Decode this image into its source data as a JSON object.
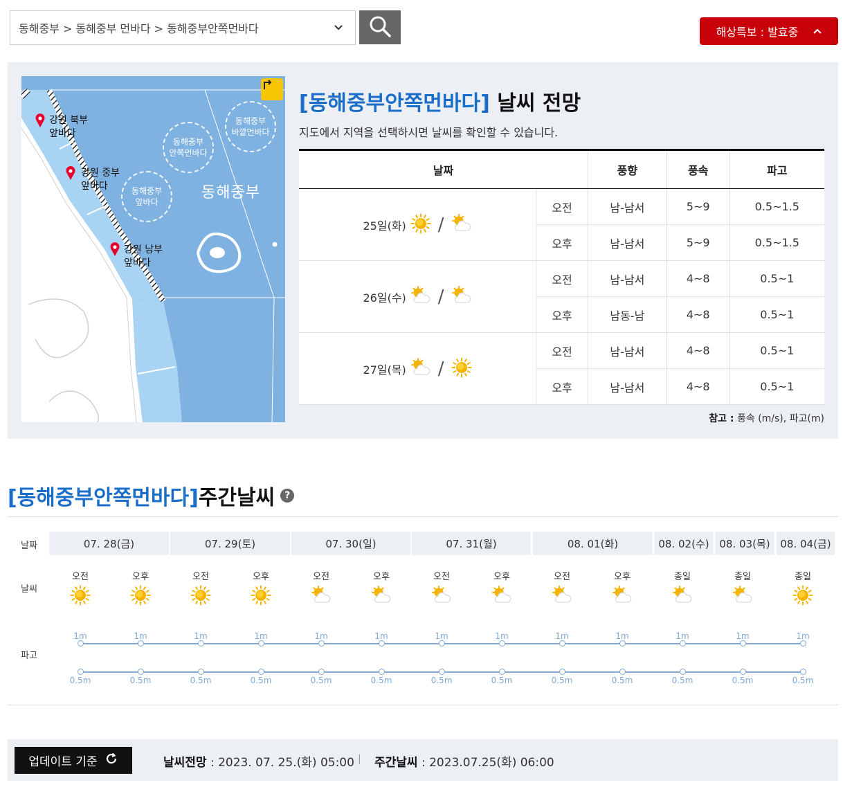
{
  "region_select": {
    "value": "동해중부 > 동해중부 먼바다 > 동해중부안쪽먼바다"
  },
  "alert": {
    "label": "해상특보 : 발효중"
  },
  "map": {
    "pins": [
      "강원 북부\n앞바다",
      "강원 중부\n앞바다",
      "강원 남부\n앞바다"
    ],
    "zones": [
      "동해중부\n앞바다",
      "동해중부\n안쪽먼바다",
      "동해중부\n바깥먼바다"
    ],
    "sea_name": "동해중부"
  },
  "forecast": {
    "title_area": "[동해중부안쪽먼바다]",
    "title_suffix": " 날씨 전망",
    "desc": "지도에서 지역을 선택하시면 날씨를 확인할 수 있습니다.",
    "headers": {
      "date": "날짜",
      "wind_dir": "풍향",
      "wind_speed": "풍속",
      "wave": "파고"
    },
    "days": [
      {
        "date": "25일(화)",
        "icons": [
          "sun-icon",
          "sun-cloud-icon"
        ],
        "rows": [
          {
            "period": "오전",
            "wind_dir": "남-남서",
            "wind_speed": "5~9",
            "wave": "0.5~1.5"
          },
          {
            "period": "오후",
            "wind_dir": "남-남서",
            "wind_speed": "5~9",
            "wave": "0.5~1.5"
          }
        ]
      },
      {
        "date": "26일(수)",
        "icons": [
          "sun-cloud-icon",
          "sun-cloud-icon"
        ],
        "rows": [
          {
            "period": "오전",
            "wind_dir": "남-남서",
            "wind_speed": "4~8",
            "wave": "0.5~1"
          },
          {
            "period": "오후",
            "wind_dir": "남동-남",
            "wind_speed": "4~8",
            "wave": "0.5~1"
          }
        ]
      },
      {
        "date": "27일(목)",
        "icons": [
          "sun-cloud-icon",
          "sun-icon"
        ],
        "rows": [
          {
            "period": "오전",
            "wind_dir": "남-남서",
            "wind_speed": "4~8",
            "wave": "0.5~1"
          },
          {
            "period": "오후",
            "wind_dir": "남-남서",
            "wind_speed": "4~8",
            "wave": "0.5~1"
          }
        ]
      }
    ],
    "note_label": "참고 :",
    "note_text": " 풍속 (m/s), 파고(m)",
    "slash": "/"
  },
  "weekly": {
    "title_area": "[동해중부안쪽먼바다]",
    "title_suffix": " 주간날씨",
    "help": "?",
    "labels": {
      "date": "날짜",
      "weather": "날씨",
      "wave": "파고"
    },
    "dates": [
      "07. 28(금)",
      "07. 29(토)",
      "07. 30(일)",
      "07. 31(월)",
      "08. 01(화)",
      "08. 02(수)",
      "08. 03(목)",
      "08. 04(금)"
    ],
    "slots": [
      {
        "period": "오전",
        "icon": "sun-icon",
        "max": "1m",
        "min": "0.5m"
      },
      {
        "period": "오후",
        "icon": "sun-icon",
        "max": "1m",
        "min": "0.5m"
      },
      {
        "period": "오전",
        "icon": "sun-icon",
        "max": "1m",
        "min": "0.5m"
      },
      {
        "period": "오후",
        "icon": "sun-icon",
        "max": "1m",
        "min": "0.5m"
      },
      {
        "period": "오전",
        "icon": "sun-cloud-icon",
        "max": "1m",
        "min": "0.5m"
      },
      {
        "period": "오후",
        "icon": "sun-cloud-icon",
        "max": "1m",
        "min": "0.5m"
      },
      {
        "period": "오전",
        "icon": "sun-cloud-icon",
        "max": "1m",
        "min": "0.5m"
      },
      {
        "period": "오후",
        "icon": "sun-cloud-icon",
        "max": "1m",
        "min": "0.5m"
      },
      {
        "period": "오전",
        "icon": "sun-cloud-icon",
        "max": "1m",
        "min": "0.5m"
      },
      {
        "period": "오후",
        "icon": "sun-cloud-icon",
        "max": "1m",
        "min": "0.5m"
      },
      {
        "period": "종일",
        "icon": "sun-cloud-icon",
        "max": "1m",
        "min": "0.5m"
      },
      {
        "period": "종일",
        "icon": "sun-cloud-icon",
        "max": "1m",
        "min": "0.5m"
      },
      {
        "period": "종일",
        "icon": "sun-icon",
        "max": "1m",
        "min": "0.5m"
      }
    ]
  },
  "footer": {
    "update_label": "업데이트 기준",
    "forecast_label": "날씨전망",
    "forecast_time": " : 2023. 07. 25.(화) 05:00",
    "weekly_label": "주간날씨",
    "weekly_time": " : 2023.07.25(화) 06:00",
    "separator": "|"
  },
  "colors": {
    "accent_blue": "#1a6dc9",
    "alert_red": "#c8000a",
    "panel_bg": "#eceff3",
    "sun": "#f5b400"
  }
}
